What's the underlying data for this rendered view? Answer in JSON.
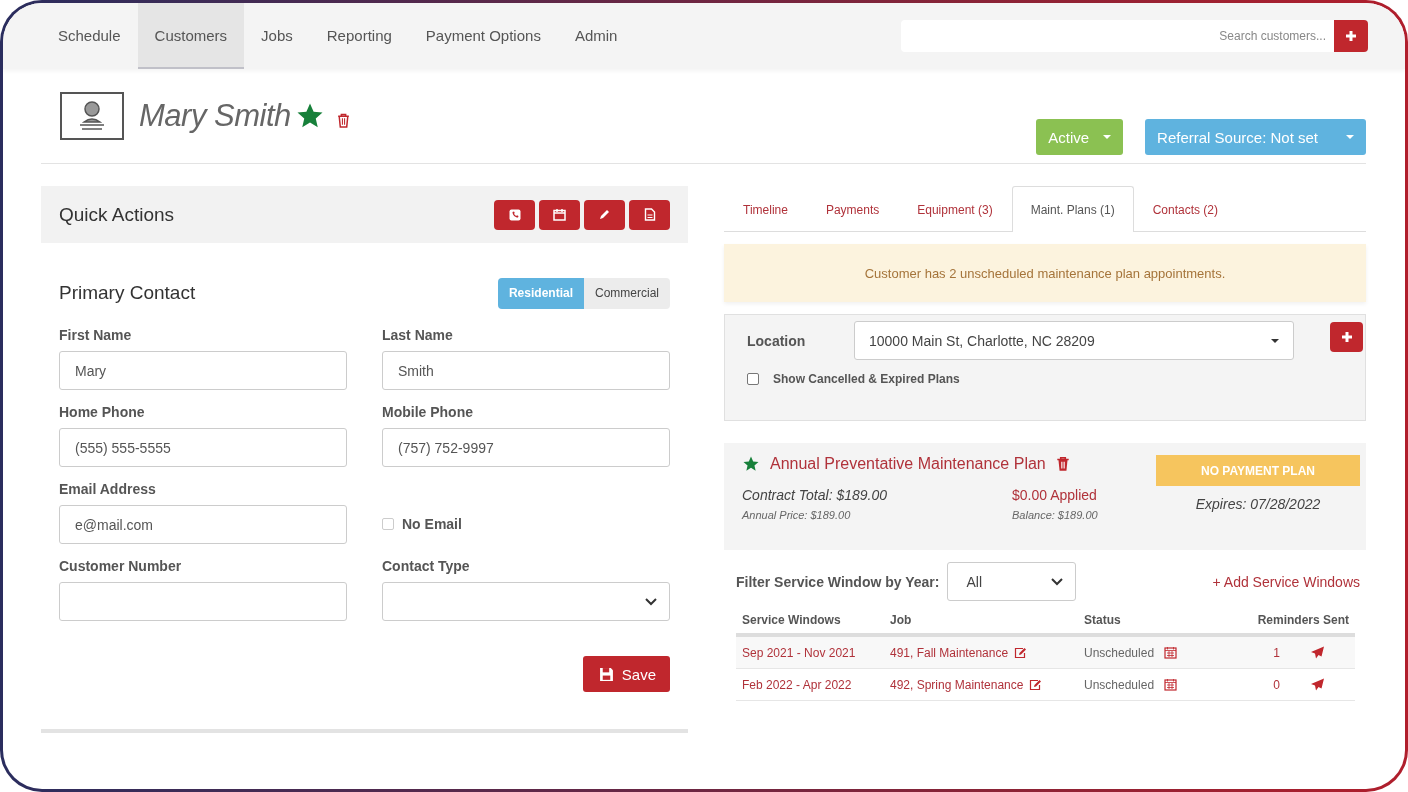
{
  "nav": {
    "items": [
      {
        "label": "Schedule",
        "selected": false
      },
      {
        "label": "Customers",
        "selected": true
      },
      {
        "label": "Jobs",
        "selected": false
      },
      {
        "label": "Reporting",
        "selected": false
      },
      {
        "label": "Payment Options",
        "selected": false
      },
      {
        "label": "Admin",
        "selected": false
      }
    ],
    "search": {
      "placeholder": "Search customers..."
    }
  },
  "customer": {
    "name": "Mary Smith",
    "favorite": true
  },
  "status_button": {
    "label": "Active"
  },
  "referral_button": {
    "label": "Referral Source: Not set"
  },
  "quick_actions": {
    "title": "Quick Actions"
  },
  "primary_contact": {
    "title": "Primary Contact",
    "types": [
      {
        "label": "Residential",
        "selected": true
      },
      {
        "label": "Commercial",
        "selected": false
      }
    ],
    "fields": [
      {
        "kind": "text",
        "label": "First Name",
        "value": "Mary"
      },
      {
        "kind": "text",
        "label": "Last Name",
        "value": "Smith"
      },
      {
        "kind": "text",
        "label": "Home Phone",
        "value": "(555) 555-5555"
      },
      {
        "kind": "text",
        "label": "Mobile Phone",
        "value": "(757) 752-9997"
      },
      {
        "kind": "text",
        "label": "Email Address",
        "value": "e@mail.com"
      },
      {
        "kind": "checkbox",
        "label": "No Email",
        "checked": false
      },
      {
        "kind": "text",
        "label": "Customer Number"
      },
      {
        "kind": "select",
        "label": "Contact Type"
      }
    ],
    "save_label": "Save"
  },
  "tabs": [
    {
      "label": "Timeline",
      "selected": false
    },
    {
      "label": "Payments",
      "selected": false
    },
    {
      "label": "Equipment (3)",
      "selected": false
    },
    {
      "label": "Maint. Plans (1)",
      "selected": true
    },
    {
      "label": "Contacts (2)",
      "selected": false
    }
  ],
  "alert": "Customer has 2 unscheduled maintenance plan appointments.",
  "location": {
    "label": "Location",
    "value": "10000 Main St, Charlotte, NC 28209",
    "show_cancelled": {
      "label": "Show Cancelled & Expired Plans",
      "checked": false
    }
  },
  "plan": {
    "favorite": true,
    "title": "Annual Preventative Maintenance Plan",
    "payment_badge": "NO PAYMENT PLAN",
    "contract_total": "Contract Total: $189.00",
    "annual_price": "Annual Price: $189.00",
    "applied": "$0.00 Applied",
    "balance": "Balance: $189.00",
    "expires": "Expires: 07/28/2022"
  },
  "filter": {
    "label": "Filter Service Window by Year:",
    "value": "All",
    "add_link": "+ Add Service Windows"
  },
  "table": {
    "columns": [
      "Service Windows",
      "Job",
      "Status",
      "Reminders Sent"
    ],
    "rows": [
      {
        "window": "Sep 2021 - Nov 2021",
        "job": "491, Fall Maintenance",
        "status": "Unscheduled",
        "reminders": "1"
      },
      {
        "window": "Feb 2022 - Apr 2022",
        "job": "492, Spring Maintenance",
        "status": "Unscheduled",
        "reminders": "0"
      }
    ]
  }
}
